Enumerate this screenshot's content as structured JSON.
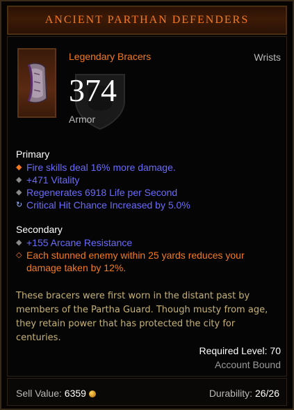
{
  "title": "ANCIENT PARTHAN DEFENDERS",
  "item_type": "Legendary Bracers",
  "slot": "Wrists",
  "armor": {
    "value": "374",
    "label": "Armor"
  },
  "primary": {
    "heading": "Primary",
    "affixes": [
      {
        "text": "Fire skills deal 16% more damage.",
        "bullet": "orange-diamond-icon"
      },
      {
        "text": "+471 Vitality",
        "bullet": "grey-diamond-icon"
      },
      {
        "text": "Regenerates 6918 Life per Second",
        "bullet": "grey-diamond-icon"
      },
      {
        "text": "Critical Hit Chance Increased by 5.0%",
        "bullet": "enchant-swirl-icon"
      }
    ]
  },
  "secondary": {
    "heading": "Secondary",
    "affixes": [
      {
        "text": "+155 Arcane Resistance",
        "bullet": "grey-diamond-icon"
      },
      {
        "text": "Each stunned enemy within 25 yards reduces your",
        "text2": "damage taken by 12%.",
        "bullet": "orange-outline-diamond-icon"
      }
    ]
  },
  "flavor": {
    "line1": "These bracers were first worn in the distant past by",
    "line2": "members of the Partha Guard. Though musty from age,",
    "line3": "they retain power that has protected the city for",
    "line4": "centuries."
  },
  "required_level": "Required Level: 70",
  "account_bound": "Account Bound",
  "footer": {
    "sell_label": "Sell Value: ",
    "sell_value": "6359",
    "durability_label": "Durability: ",
    "durability_value": "26/26"
  },
  "colors": {
    "legendary": "#f47a22",
    "magic": "#6b6bff",
    "flavor": "#c7b377"
  }
}
